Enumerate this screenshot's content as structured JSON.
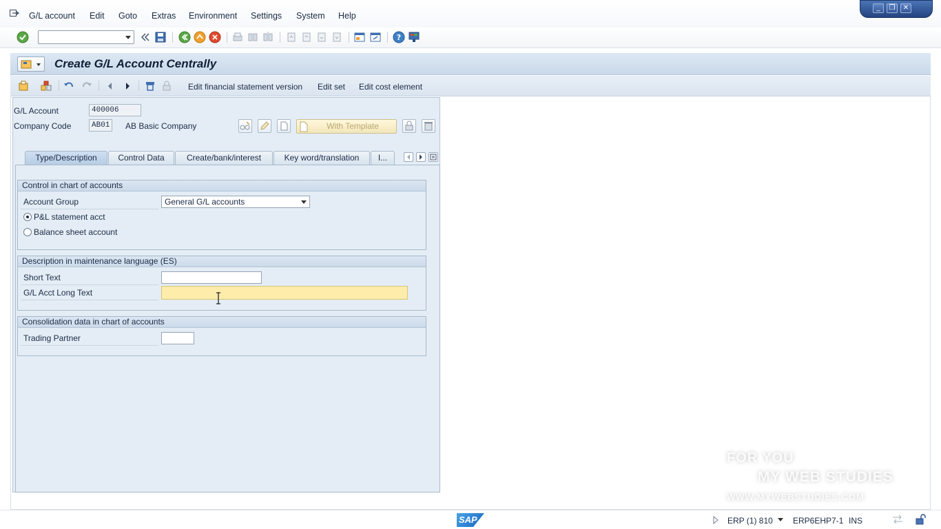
{
  "menu": {
    "items": [
      "G/L account",
      "Edit",
      "Goto",
      "Extras",
      "Environment",
      "Settings",
      "System",
      "Help"
    ]
  },
  "window_controls": {
    "minimize": "_",
    "restore": "❐",
    "close": "✕"
  },
  "page": {
    "title": "Create G/L Account Centrally"
  },
  "app_toolbar": {
    "links": [
      "Edit financial statement version",
      "Edit set",
      "Edit cost element"
    ]
  },
  "header_fields": {
    "gl_account_label": "G/L Account",
    "gl_account_value": "400006",
    "company_code_label": "Company Code",
    "company_code_value": "AB01",
    "company_name": "AB Basic Company",
    "with_template_label": "With Template"
  },
  "tabs": [
    {
      "label": "Type/Description",
      "active": true
    },
    {
      "label": "Control Data",
      "active": false
    },
    {
      "label": "Create/bank/interest",
      "active": false
    },
    {
      "label": "Key word/translation",
      "active": false
    },
    {
      "label": "I...",
      "active": false
    }
  ],
  "group_control": {
    "title": "Control in chart of accounts",
    "account_group_label": "Account Group",
    "account_group_value": "General G/L accounts",
    "radio_pl": "P&L statement acct",
    "radio_bs": "Balance sheet account",
    "selected": "pl"
  },
  "group_description": {
    "title": "Description in maintenance language (ES)",
    "short_text_label": "Short Text",
    "short_text_value": "",
    "long_text_label": "G/L Acct Long Text",
    "long_text_value": ""
  },
  "group_consolidation": {
    "title": "Consolidation data in chart of accounts",
    "trading_partner_label": "Trading Partner",
    "trading_partner_value": ""
  },
  "status_bar": {
    "logo": "SAP",
    "system": "ERP (1) 810",
    "server": "ERP6EHP7-1",
    "mode": "INS"
  },
  "watermark": {
    "line1": "FOR YOU",
    "line2": "MY WEB STUDIES",
    "line3": "WWW.MYWEBSTUDIES.COM"
  },
  "colors": {
    "accent": "#4a74b5",
    "title_bar": "#c9d9ea",
    "panel_bg": "#e4edf5",
    "focus_field": "#fdecaa"
  }
}
